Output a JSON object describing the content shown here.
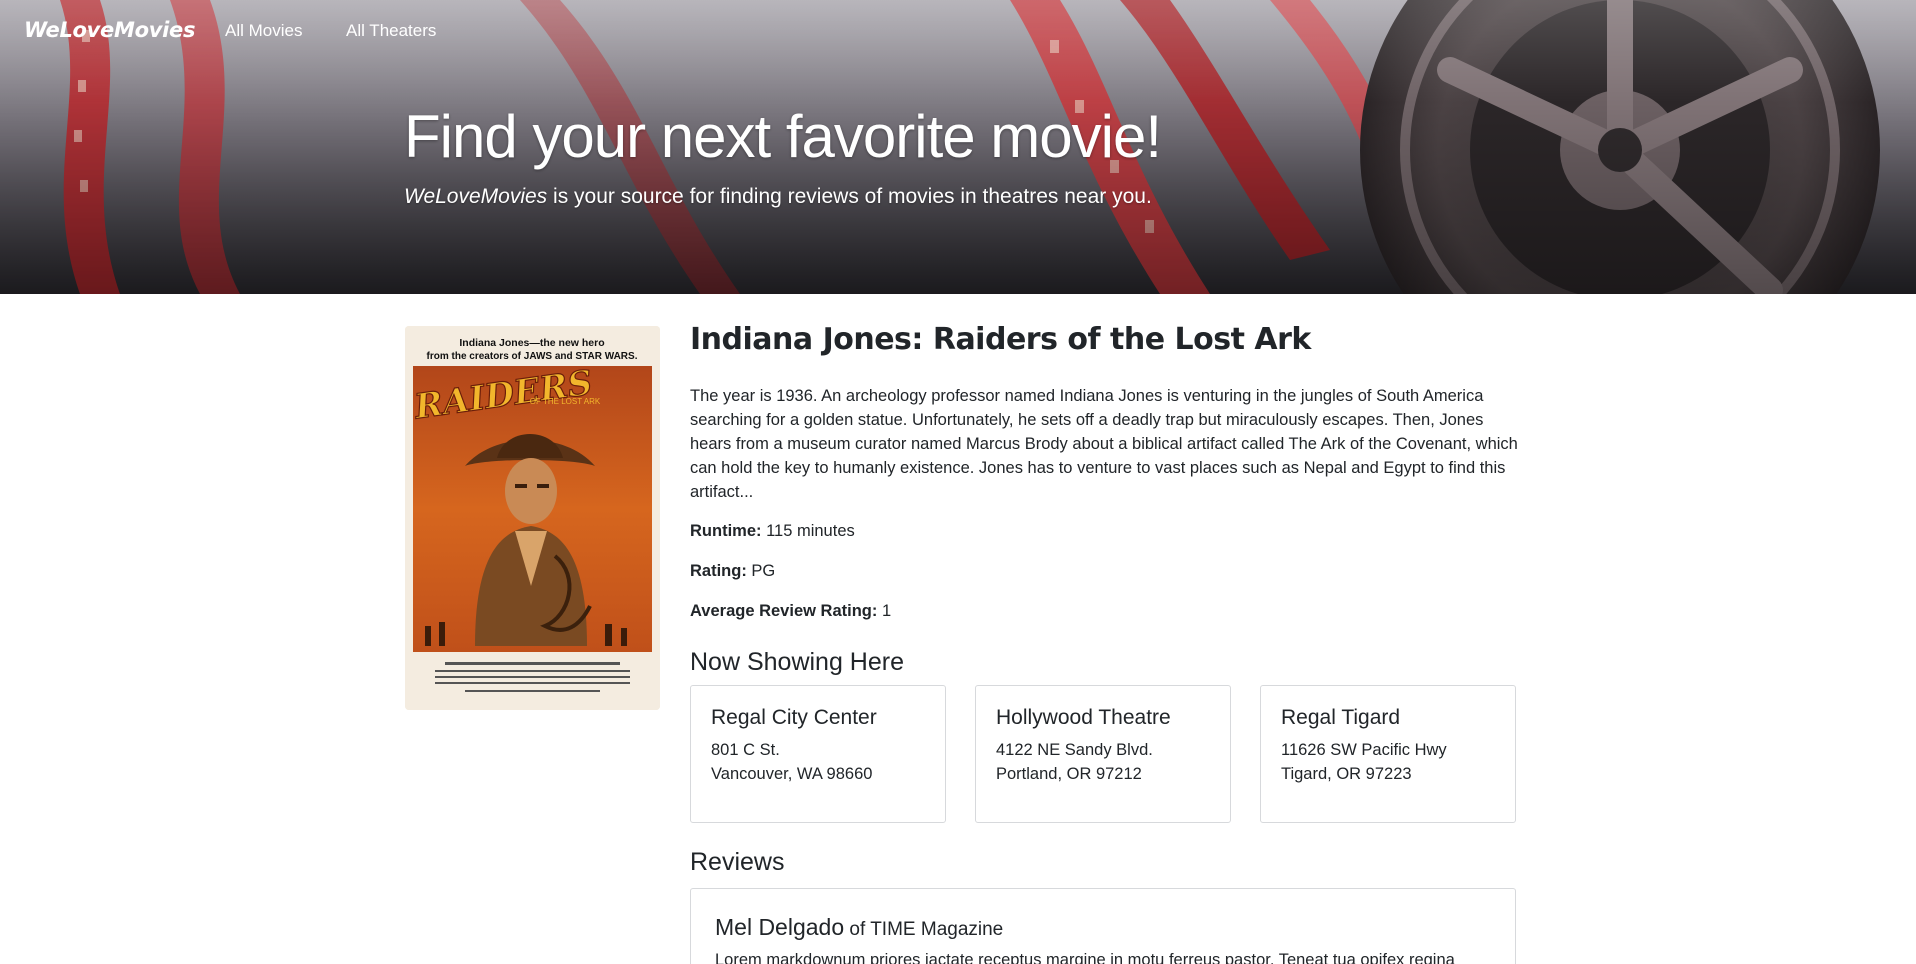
{
  "nav": {
    "brand": "WeLoveMovies",
    "links": [
      "All Movies",
      "All Theaters"
    ]
  },
  "hero": {
    "title": "Find your next favorite movie!",
    "subtitle_brand": "WeLoveMovies",
    "subtitle_rest": " is your source for finding reviews of movies in theatres near you."
  },
  "poster": {
    "tagline_1": "Indiana Jones—the new hero",
    "tagline_2": "from the creators of JAWS and STAR WARS.",
    "logo_text": "RAIDERS",
    "logo_sub": "OF THE LOST ARK"
  },
  "movie": {
    "title": "Indiana Jones: Raiders of the Lost Ark",
    "description": "The year is 1936. An archeology professor named Indiana Jones is venturing in the jungles of South America searching for a golden statue. Unfortunately, he sets off a deadly trap but miraculously escapes. Then, Jones hears from a museum curator named Marcus Brody about a biblical artifact called The Ark of the Covenant, which can hold the key to humanly existence. Jones has to venture to vast places such as Nepal and Egypt to find this artifact...",
    "runtime_label": "Runtime:",
    "runtime_value": " 115 minutes",
    "rating_label": "Rating:",
    "rating_value": " PG",
    "avg_label": "Average Review Rating:",
    "avg_value": " 1"
  },
  "showing": {
    "heading": "Now Showing Here",
    "theaters": [
      {
        "name": "Regal City Center",
        "line1": "801 C St.",
        "line2": "Vancouver, WA 98660"
      },
      {
        "name": "Hollywood Theatre",
        "line1": "4122 NE Sandy Blvd.",
        "line2": "Portland, OR 97212"
      },
      {
        "name": "Regal Tigard",
        "line1": "11626 SW Pacific Hwy",
        "line2": "Tigard, OR 97223"
      }
    ]
  },
  "reviews": {
    "heading": "Reviews",
    "items": [
      {
        "critic": "Mel Delgado",
        "publication": " of TIME Magazine",
        "text": "Lorem markdownum priores iactate receptus margine in motu ferreus pastor. Teneat tua opifex regina"
      }
    ]
  },
  "colors": {
    "text": "#212529",
    "card_border": "#d7d9dc",
    "hero_dark": "#2d2c31",
    "film_red": "#c0282d"
  }
}
